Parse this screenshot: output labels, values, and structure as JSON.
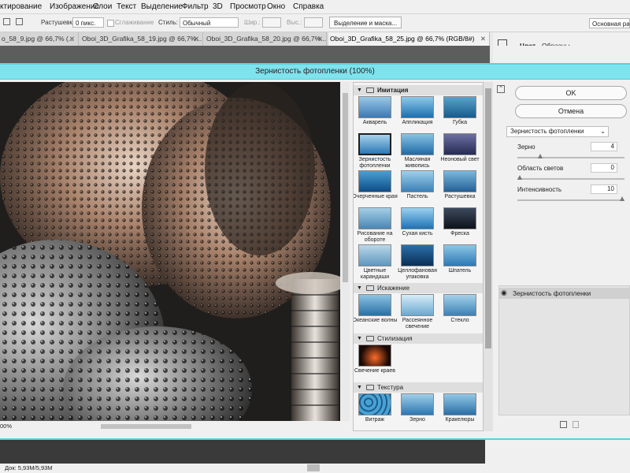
{
  "menu": [
    "ктирование",
    "Изображение",
    "Слои",
    "Текст",
    "Выделение",
    "Фильтр",
    "3D",
    "Просмотр",
    "Окно",
    "Справка"
  ],
  "options": {
    "feather_label": "Растушевка:",
    "feather_value": "0 пикс.",
    "antialias_label": "Сглаживание",
    "style_label": "Стиль:",
    "style_value": "Обычный",
    "width_label": "Шир.:",
    "height_label": "Выс.:",
    "select_mask_btn": "Выделение и маска...",
    "workspace_value": "Основная рабоч"
  },
  "tabs": [
    {
      "label": "o_58_9.jpg @ 66,7% (..."
    },
    {
      "label": "Oboi_3D_Grafika_58_19.jpg @ 66,7%..."
    },
    {
      "label": "Oboi_3D_Grafika_58_20.jpg @ 66,7%..."
    },
    {
      "label": "Oboi_3D_Grafika_58_25.jpg @ 66,7% (RGB/8#)"
    }
  ],
  "side_tabs": {
    "color": "Цвет",
    "swatches": "Образцы"
  },
  "dialog": {
    "title": "Зернистость фотопленки (100%)",
    "zoom": "00%",
    "ok": "OK",
    "cancel": "Отмена",
    "filter_select": "Зернистость фотопленки",
    "params": [
      {
        "label": "Зерно",
        "value": "4",
        "pos": 0.2
      },
      {
        "label": "Область светов",
        "value": "0",
        "pos": 0.0
      },
      {
        "label": "Интенсивность",
        "value": "10",
        "pos": 1.0
      }
    ],
    "applied_layer": "Зернистость фотопленки"
  },
  "gallery": {
    "categories": [
      {
        "name": "Имитация",
        "items": [
          "Акварель",
          "Аппликация",
          "Губка",
          "Зернистость фотопленки",
          "Масляная живопись",
          "Неоновый свет",
          "Очерченные края",
          "Пастель",
          "Растушевка",
          "Рисование на обороте",
          "Сухая кисть",
          "Фреска",
          "Цветные карандаши",
          "Целлофановая упаковка",
          "Шпатель"
        ]
      },
      {
        "name": "Искажение",
        "items": [
          "Океанские волны",
          "Рассеянное свечение",
          "Стекло"
        ]
      },
      {
        "name": "Стилизация",
        "items": [
          "Свечение краев"
        ]
      },
      {
        "name": "Текстура",
        "items": [
          "Витраж",
          "Зерно",
          "Кракелюры"
        ]
      }
    ]
  },
  "status": "Док: 5,93M/5,93M",
  "colors": {
    "dialog_title_bg": "#7fe3ee",
    "selected_border": "#1f1f1f"
  }
}
